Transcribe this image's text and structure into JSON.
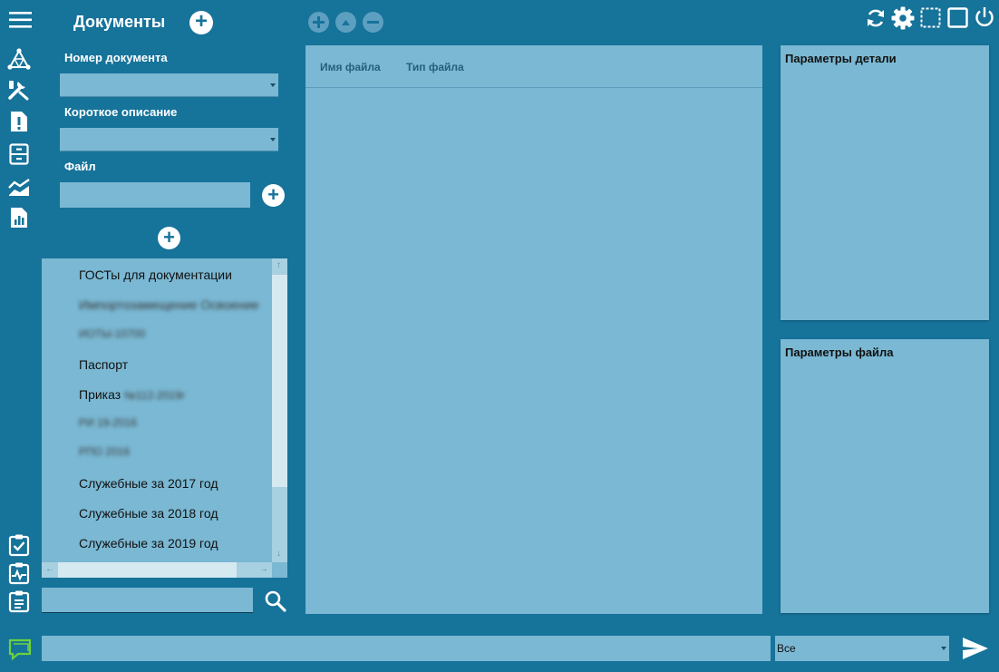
{
  "app": {
    "title": "Документы"
  },
  "form": {
    "doc_number_label": "Номер документа",
    "doc_number_value": "",
    "short_desc_label": "Короткое описание",
    "short_desc_value": "",
    "file_label": "Файл",
    "file_value": ""
  },
  "list": {
    "items": [
      {
        "label": "ГОСТы для документации",
        "blurred": false
      },
      {
        "label": "Импортозамещение Освоение",
        "blurred": true
      },
      {
        "label": "ИОТЫ-10700",
        "blurred": true
      },
      {
        "label": "Паспорт",
        "blurred": false
      },
      {
        "label": "Приказ",
        "suffix": "№112-2019г",
        "blurred": false
      },
      {
        "label": "РИ 19-2016",
        "blurred": true
      },
      {
        "label": "РПО 2016",
        "blurred": true
      },
      {
        "label": "Служебные за 2017 год",
        "blurred": false
      },
      {
        "label": "Служебные за 2018 год",
        "blurred": false
      },
      {
        "label": "Служебные за 2019 год",
        "blurred": false
      }
    ]
  },
  "search": {
    "value": ""
  },
  "table": {
    "col_filename": "Имя файла",
    "col_filetype": "Тип файла"
  },
  "panels": {
    "detail_params": "Параметры детали",
    "file_params": "Параметры файла"
  },
  "bottom": {
    "chat_value": "",
    "filter_value": "Все"
  },
  "colors": {
    "background": "#16739a",
    "panel": "#7ab8d3",
    "chat_icon": "#6bd13c"
  },
  "icons": {
    "menu": "hamburger-icon",
    "refresh": "refresh-icon",
    "settings": "gear-icon",
    "select_area": "dashed-square-icon",
    "window": "square-icon",
    "power": "power-icon",
    "send": "send-icon",
    "search": "search-icon",
    "chat": "chat-icon"
  }
}
